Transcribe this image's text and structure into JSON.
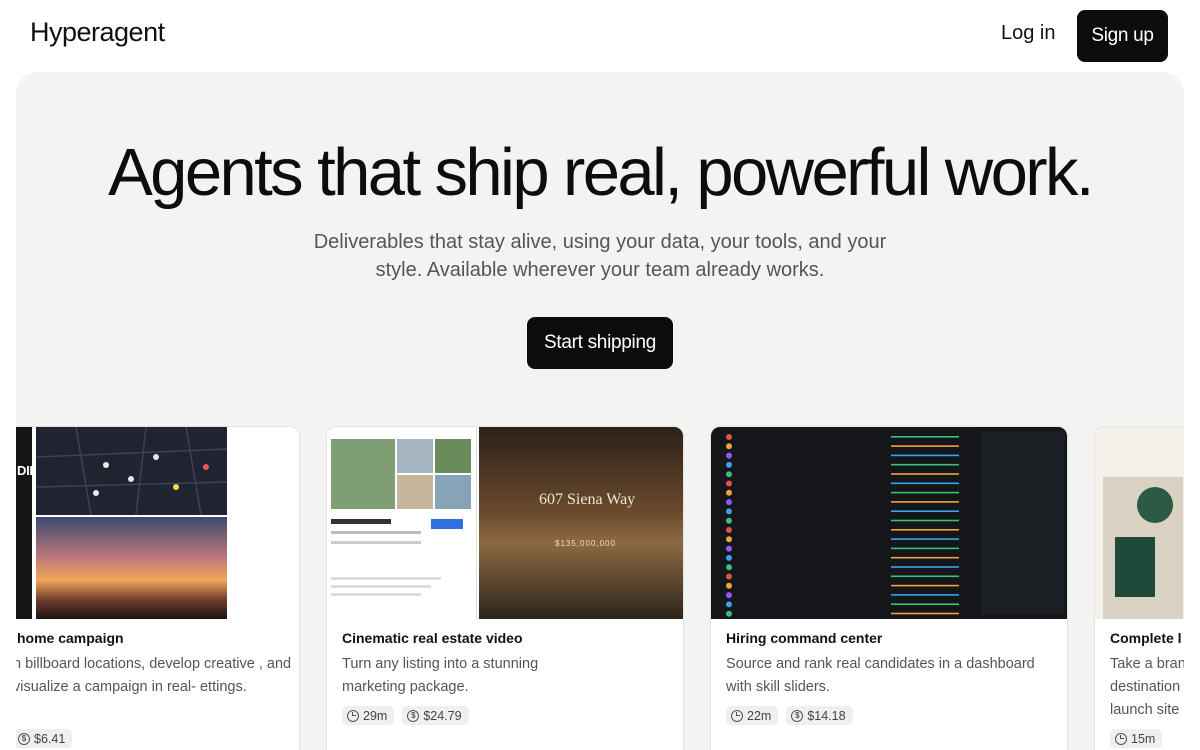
{
  "header": {
    "logo": "Hyperagent",
    "login_label": "Log in",
    "signup_label": "Sign up"
  },
  "hero": {
    "headline": "Agents that ship real, powerful work.",
    "subhead": "Deliverables that stay alive, using your data, your tools, and your style. Available wherever your team already works.",
    "cta_label": "Start shipping"
  },
  "cards": [
    {
      "title": "home campaign",
      "description": "h billboard locations, develop creative , and visualize a campaign in real- ettings.",
      "time": "",
      "cost": "$6.41",
      "thumb_text": "DIRECTING."
    },
    {
      "title": "Cinematic real estate video",
      "description": "Turn any listing into a stunning marketing package.",
      "time": "29m",
      "cost": "$24.79",
      "thumb_text": "607 Siena Way",
      "thumb_price": "$135,000,000"
    },
    {
      "title": "Hiring command center",
      "description": "Source and rank real candidates in a dashboard with skill sliders.",
      "time": "22m",
      "cost": "$14.18"
    },
    {
      "title": "Complete l",
      "description": "Take a bran destination launch site",
      "time": "15m",
      "cost": ""
    }
  ],
  "icons": {
    "time": "clock-icon",
    "cost": "dollar-icon"
  },
  "colors": {
    "primary_button": "#0c0c0c",
    "hero_background": "#f3f3f2"
  }
}
